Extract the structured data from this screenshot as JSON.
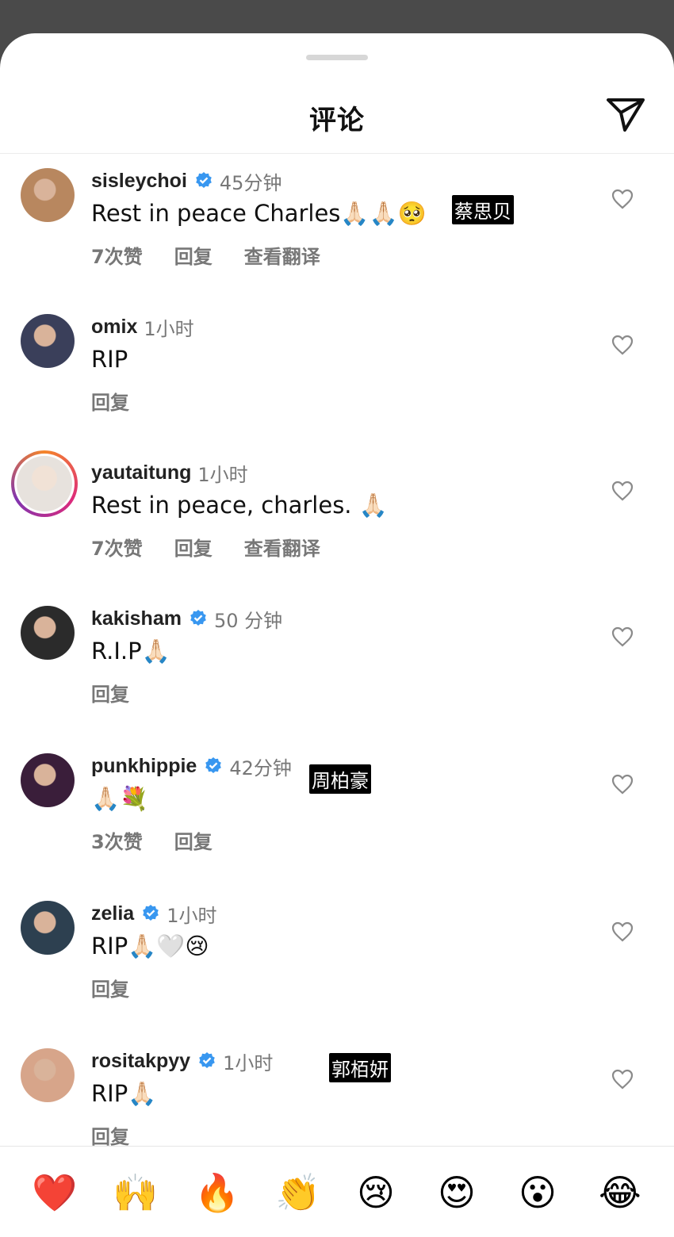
{
  "sheet": {
    "title": "评论"
  },
  "comments": [
    {
      "username": "sisleychoi",
      "verified": true,
      "time": "45分钟",
      "text": "Rest in peace Charles🙏🏻🙏🏻🥺",
      "likes": "7次赞",
      "reply": "回复",
      "translate": "查看翻译",
      "caption": "蔡思贝",
      "avatar_color": "#b8875f"
    },
    {
      "username": "omix",
      "verified": false,
      "time": "1小时",
      "text": "RIP",
      "likes": "",
      "reply": "回复",
      "translate": "",
      "caption": "",
      "avatar_color": "#3a3f5a"
    },
    {
      "username": "yautaitung",
      "verified": false,
      "time": "1小时",
      "text": "Rest in peace, charles. 🙏🏻",
      "likes": "7次赞",
      "reply": "回复",
      "translate": "查看翻译",
      "caption": "",
      "avatar_color": "#e7e2dd",
      "story": true
    },
    {
      "username": "kakisham",
      "verified": true,
      "time": "50 分钟",
      "text": "R.I.P🙏🏻",
      "likes": "",
      "reply": "回复",
      "translate": "",
      "caption": "",
      "avatar_color": "#2b2b2b"
    },
    {
      "username": "punkhippie",
      "verified": true,
      "time": "42分钟",
      "text": "🙏🏻💐",
      "likes": "3次赞",
      "reply": "回复",
      "translate": "",
      "caption": "周柏豪",
      "avatar_color": "#3a1e3a"
    },
    {
      "username": "zelia",
      "verified": true,
      "time": "1小时",
      "text": "RIP🙏🏻🤍😢",
      "likes": "",
      "reply": "回复",
      "translate": "",
      "caption": "",
      "avatar_color": "#2d4050"
    },
    {
      "username": "rositakpyy",
      "verified": true,
      "time": "1小时",
      "text": "RIP🙏🏻",
      "likes": "",
      "reply": "回复",
      "translate": "",
      "caption": "郭栢妍",
      "avatar_color": "#d7a58a"
    }
  ],
  "emoji_bar": [
    "❤️",
    "🙌",
    "🔥",
    "👏",
    "😢",
    "😍",
    "😮",
    "😂"
  ],
  "colors": {
    "verified": "#3897f0",
    "meta_text": "#777777"
  }
}
